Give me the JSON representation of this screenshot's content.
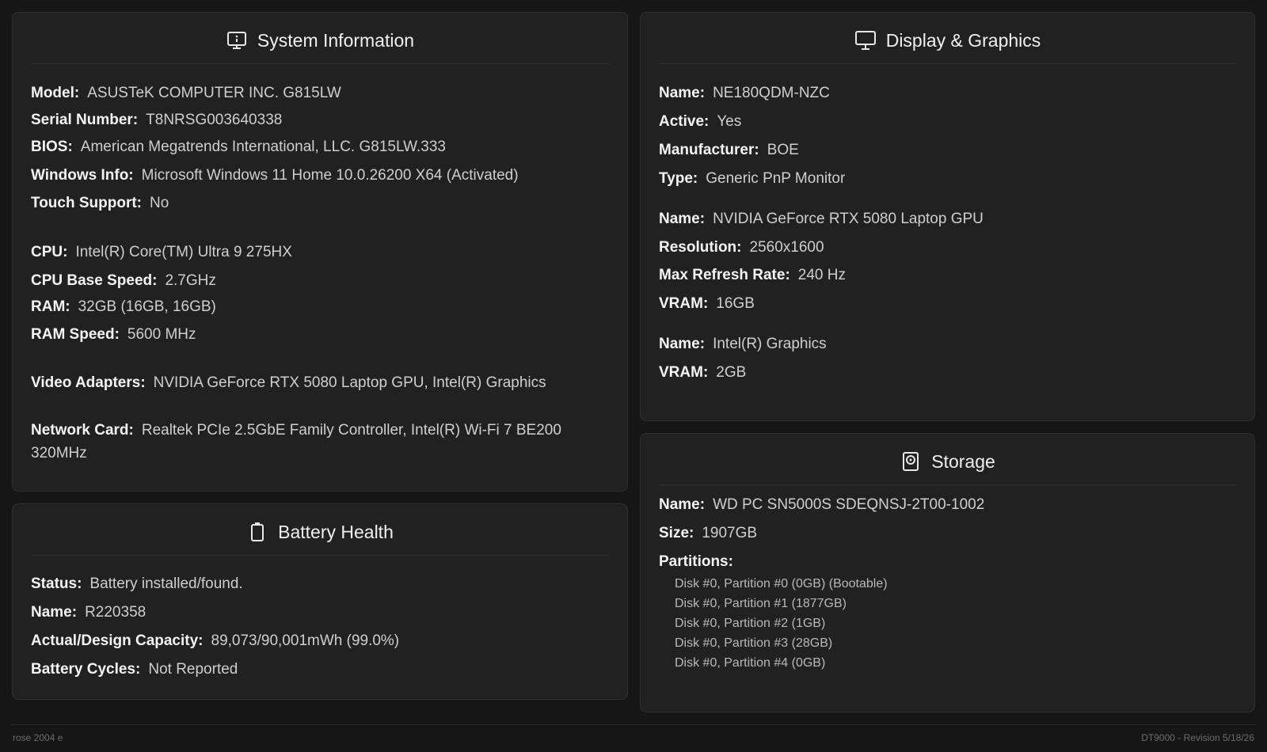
{
  "system": {
    "title": "System Information",
    "icon": "monitor-info-icon",
    "model_label": "Model:",
    "model": "ASUSTeK COMPUTER INC. G815LW",
    "serial_label": "Serial Number:",
    "serial": "T8NRSG003640338",
    "bios_label": "BIOS:",
    "bios": "American Megatrends International, LLC. G815LW.333",
    "windows_label": "Windows Info:",
    "windows": "Microsoft Windows 11 Home 10.0.26200 X64 (Activated)",
    "touch_label": "Touch Support:",
    "touch": "No",
    "cpu_label": "CPU:",
    "cpu": "Intel(R) Core(TM) Ultra 9 275HX",
    "cpu_speed_label": "CPU Base Speed:",
    "cpu_speed": "2.7GHz",
    "ram_label": "RAM:",
    "ram": "32GB (16GB, 16GB)",
    "ram_speed_label": "RAM Speed:",
    "ram_speed": "5600 MHz",
    "video_label": "Video Adapters:",
    "video": "NVIDIA GeForce RTX 5080 Laptop GPU, Intel(R) Graphics",
    "network_label": "Network Card:",
    "network": "Realtek PCIe 2.5GbE Family Controller, Intel(R) Wi-Fi 7 BE200 320MHz"
  },
  "display": {
    "title": "Display & Graphics",
    "icon": "monitor-icon",
    "monitor": {
      "name_label": "Name:",
      "name": "NE180QDM-NZC",
      "active_label": "Active:",
      "active": "Yes",
      "manufacturer_label": "Manufacturer:",
      "manufacturer": "BOE",
      "type_label": "Type:",
      "type": "Generic PnP Monitor"
    },
    "gpu1": {
      "name_label": "Name:",
      "name": "NVIDIA GeForce RTX 5080 Laptop GPU",
      "resolution_label": "Resolution:",
      "resolution": "2560x1600",
      "refresh_label": "Max Refresh Rate:",
      "refresh": "240 Hz",
      "vram_label": "VRAM:",
      "vram": "16GB"
    },
    "gpu2": {
      "name_label": "Name:",
      "name": "Intel(R) Graphics",
      "vram_label": "VRAM:",
      "vram": "2GB"
    }
  },
  "battery": {
    "title": "Battery Health",
    "icon": "battery-icon",
    "status_label": "Status:",
    "status": "Battery installed/found.",
    "name_label": "Name:",
    "name": "R220358",
    "capacity_label": "Actual/Design Capacity:",
    "capacity": "89,073/90,001mWh (99.0%)",
    "cycles_label": "Battery Cycles:",
    "cycles": "Not Reported"
  },
  "storage": {
    "title": "Storage",
    "icon": "disk-icon",
    "name_label": "Name:",
    "name": "WD PC SN5000S SDEQNSJ-2T00-1002",
    "size_label": "Size:",
    "size": "1907GB",
    "partitions_label": "Partitions:",
    "partitions": [
      "Disk #0, Partition #0 (0GB) (Bootable)",
      "Disk #0, Partition #1 (1877GB)",
      "Disk #0, Partition #2 (1GB)",
      "Disk #0, Partition #3 (28GB)",
      "Disk #0, Partition #4 (0GB)"
    ]
  },
  "footer": {
    "left": "rose 2004 e",
    "right": "DT9000 - Revision 5/18/26"
  },
  "colors": {
    "background": "#161617",
    "card": "#212122",
    "border": "#303032",
    "text": "#cfcfcf",
    "label": "#f4f4f4"
  }
}
